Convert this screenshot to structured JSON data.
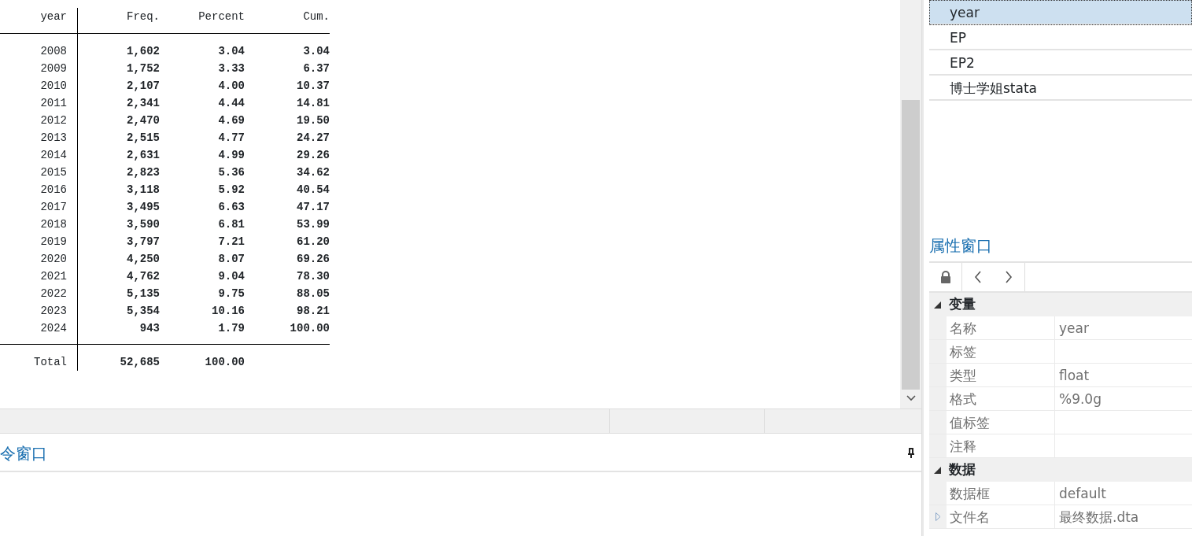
{
  "results": {
    "columns": [
      "year",
      "Freq.",
      "Percent",
      "Cum."
    ],
    "rows": [
      [
        "2008",
        "1,602",
        "3.04",
        "3.04"
      ],
      [
        "2009",
        "1,752",
        "3.33",
        "6.37"
      ],
      [
        "2010",
        "2,107",
        "4.00",
        "10.37"
      ],
      [
        "2011",
        "2,341",
        "4.44",
        "14.81"
      ],
      [
        "2012",
        "2,470",
        "4.69",
        "19.50"
      ],
      [
        "2013",
        "2,515",
        "4.77",
        "24.27"
      ],
      [
        "2014",
        "2,631",
        "4.99",
        "29.26"
      ],
      [
        "2015",
        "2,823",
        "5.36",
        "34.62"
      ],
      [
        "2016",
        "3,118",
        "5.92",
        "40.54"
      ],
      [
        "2017",
        "3,495",
        "6.63",
        "47.17"
      ],
      [
        "2018",
        "3,590",
        "6.81",
        "53.99"
      ],
      [
        "2019",
        "3,797",
        "7.21",
        "61.20"
      ],
      [
        "2020",
        "4,250",
        "8.07",
        "69.26"
      ],
      [
        "2021",
        "4,762",
        "9.04",
        "78.30"
      ],
      [
        "2022",
        "5,135",
        "9.75",
        "88.05"
      ],
      [
        "2023",
        "5,354",
        "10.16",
        "98.21"
      ],
      [
        "2024",
        "943",
        "1.79",
        "100.00"
      ]
    ],
    "total": [
      "Total",
      "52,685",
      "100.00"
    ]
  },
  "command_window": {
    "title": "令窗口"
  },
  "variables": [
    {
      "name": "year",
      "selected": true
    },
    {
      "name": "EP",
      "selected": false
    },
    {
      "name": "EP2",
      "selected": false
    },
    {
      "name": "博士学姐stata",
      "selected": false
    }
  ],
  "properties": {
    "title": "属性窗口",
    "sections": [
      {
        "title": "变量",
        "expanded": true,
        "rows": [
          {
            "name": "名称",
            "value": "year",
            "expandable": false
          },
          {
            "name": "标签",
            "expandable": false
          },
          {
            "name": "类型",
            "value": "float",
            "expandable": false
          },
          {
            "name": "格式",
            "value": "%9.0g",
            "expandable": false
          },
          {
            "name": "值标签",
            "expandable": false
          },
          {
            "name": "注释",
            "expandable": false
          }
        ]
      },
      {
        "title": "数据",
        "expanded": true,
        "rows": [
          {
            "name": "数据框",
            "value": "default",
            "expandable": false
          },
          {
            "name": "文件名",
            "value": "最终数据.dta",
            "expandable": true
          }
        ]
      }
    ]
  }
}
